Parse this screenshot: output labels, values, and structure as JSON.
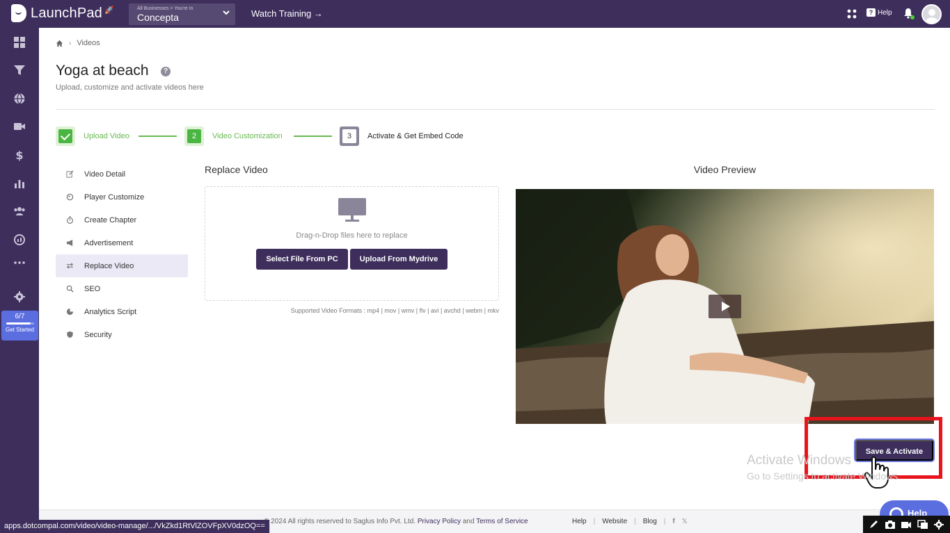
{
  "app": {
    "logo": "LaunchPad"
  },
  "business": {
    "caption": "All Businesses > You're In",
    "name": "Concepta"
  },
  "topbar": {
    "watch_training": "Watch Training →",
    "help": "Help"
  },
  "rail": {
    "get_started_count": "6/7",
    "get_started_label": "Get Started",
    "progress": 0.857
  },
  "breadcrumb": {
    "current": "Videos"
  },
  "page": {
    "title": "Yoga at beach",
    "subtitle": "Upload, customize and activate videos here"
  },
  "stepper": {
    "steps": [
      {
        "number": "1",
        "label": "Upload Video",
        "status": "done"
      },
      {
        "number": "2",
        "label": "Video Customization",
        "status": "done"
      },
      {
        "number": "3",
        "label": "Activate & Get Embed Code",
        "status": "current"
      }
    ]
  },
  "sidenav": {
    "items": [
      {
        "label": "Video Detail",
        "icon": "edit-icon"
      },
      {
        "label": "Player Customize",
        "icon": "palette-icon"
      },
      {
        "label": "Create Chapter",
        "icon": "timer-icon"
      },
      {
        "label": "Advertisement",
        "icon": "megaphone-icon"
      },
      {
        "label": "Replace Video",
        "icon": "swap-icon",
        "active": true
      },
      {
        "label": "SEO",
        "icon": "search-icon"
      },
      {
        "label": "Analytics Script",
        "icon": "analytics-icon"
      },
      {
        "label": "Security",
        "icon": "shield-icon"
      }
    ]
  },
  "replace": {
    "title": "Replace Video",
    "drop_text": "Drag-n-Drop files here to replace",
    "select_pc": "Select File From PC",
    "upload_mydrive": "Upload From Mydrive",
    "formats": "Supported Video Formats : mp4 | mov | wmv | flv | avi | avchd | webm | mkv"
  },
  "preview": {
    "title": "Video Preview"
  },
  "actions": {
    "save_activate": "Save & Activate"
  },
  "watermark": {
    "line1": "Activate Windows",
    "line2": "Go to Settings to activate Windows."
  },
  "footer": {
    "copyright": "© 2024 All rights reserved to Saglus Info Pvt. Ltd.",
    "privacy": "Privacy Policy",
    "and": "and",
    "terms": "Terms of Service",
    "help": "Help",
    "website": "Website",
    "blog": "Blog",
    "help_button": "Help"
  },
  "status_url": "apps.dotcompal.com/video/video-manage/.../VkZkd1RtVlZOVFpXV0dzOQ==",
  "colors": {
    "brand": "#3d2e5c",
    "accent": "#5b6ee0",
    "success": "#4bb543",
    "highlight": "#e8141c"
  }
}
